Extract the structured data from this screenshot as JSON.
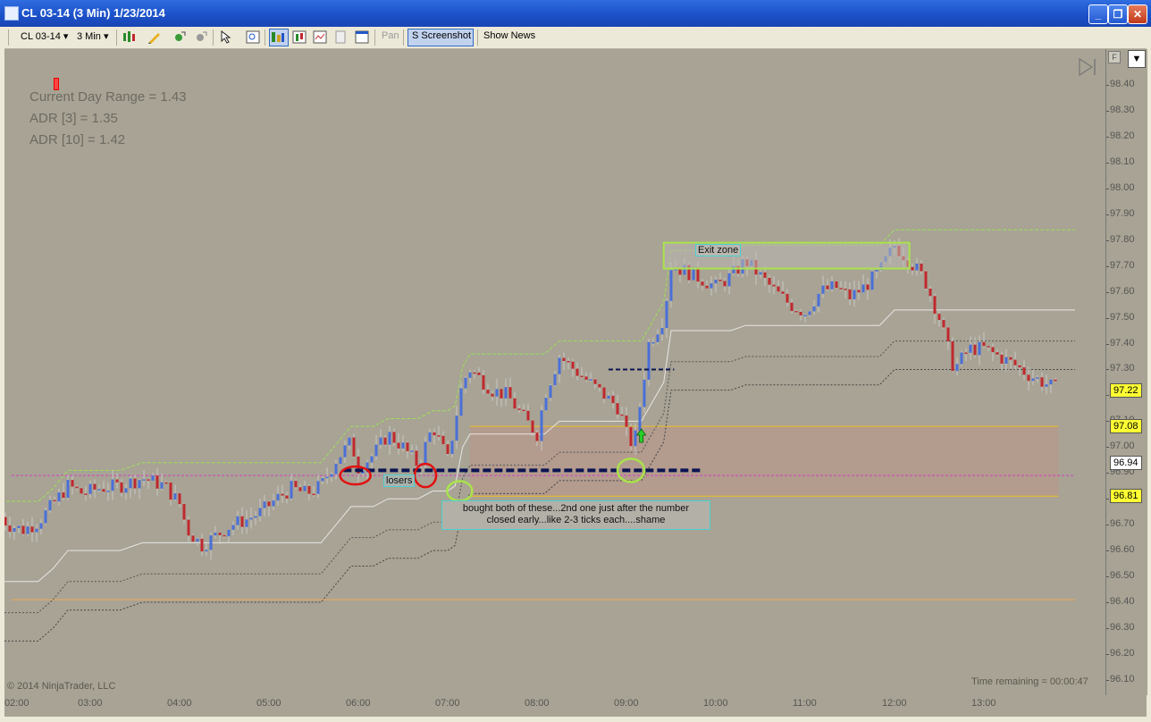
{
  "window": {
    "title": "CL 03-14 (3 Min)  1/23/2014",
    "buttons": [
      "_",
      "❐",
      "✕"
    ]
  },
  "toolbar": {
    "instrument": "CL 03-14",
    "interval": "3 Min",
    "pan": "Pan",
    "screenshot": "S Screenshot",
    "show_news": "Show News",
    "dropdown_arrow": "▾"
  },
  "stats": {
    "line1": "Current Day Range = 1.43",
    "line2": "ADR [3] = 1.35",
    "line3": "ADR [10] = 1.42"
  },
  "annotations": {
    "exit_zone": "Exit zone",
    "losers": "losers",
    "note_line1": "bought both of these...2nd one just after the number",
    "note_line2": "closed early...like 2-3 ticks each....shame"
  },
  "footer": {
    "copyright": "© 2014 NinjaTrader, LLC",
    "time_remaining": "Time remaining = 00:00:47"
  },
  "axis_panel": {
    "f_button": "F",
    "dropdown": "▼"
  },
  "price_axis": {
    "labels": [
      "98.40",
      "98.30",
      "98.20",
      "98.10",
      "98.00",
      "97.90",
      "97.80",
      "97.70",
      "97.60",
      "97.50",
      "97.40",
      "97.30",
      "97.20",
      "97.10",
      "97.00",
      "96.90",
      "96.80",
      "96.70",
      "96.60",
      "96.50",
      "96.40",
      "96.30",
      "96.20",
      "96.10"
    ],
    "top_value": 98.4,
    "bottom_value": 96.1
  },
  "price_tags": [
    {
      "label": "97.22",
      "value": 97.22,
      "bg": "#ffff33"
    },
    {
      "label": "97.08",
      "value": 97.08,
      "bg": "#ffff33"
    },
    {
      "label": "96.94",
      "value": 96.94,
      "bg": "#ffffff"
    },
    {
      "label": "96.81",
      "value": 96.81,
      "bg": "#ffff33"
    }
  ],
  "time_axis": {
    "labels": [
      "02:00",
      "03:00",
      "04:00",
      "05:00",
      "06:00",
      "07:00",
      "08:00",
      "09:00",
      "10:00",
      "11:00",
      "12:00",
      "13:00"
    ]
  },
  "colors": {
    "background": "#a8a394",
    "up_candle": "#4a6fd8",
    "down_candle": "#c0282e",
    "wick": "#c8c8c8",
    "zone_fill": "#b8978a",
    "magenta_line": "#d53fc0",
    "orange_line": "#f0a85a",
    "green_dashed": "#9de05a",
    "exit_zone_border": "#a9e34b",
    "annotation_border": "#4ad1d1"
  },
  "chart_data": {
    "type": "candlestick",
    "x_range": [
      "02:00",
      "13:50"
    ],
    "y_range": [
      96.1,
      98.4
    ],
    "levels": {
      "magenta_line": 96.89,
      "orange_line": 96.41,
      "zone_top": 97.08,
      "zone_bottom": 96.81,
      "exit_zone": [
        97.69,
        97.79
      ],
      "entry_dashed": 96.91,
      "short_dashed_0910": 97.3
    },
    "close_path": [
      [
        "02:00",
        96.73
      ],
      [
        "02:05",
        96.7
      ],
      [
        "02:15",
        96.68
      ],
      [
        "02:25",
        96.71
      ],
      [
        "02:35",
        96.78
      ],
      [
        "02:45",
        96.85
      ],
      [
        "02:55",
        96.82
      ],
      [
        "03:05",
        96.84
      ],
      [
        "03:20",
        96.85
      ],
      [
        "03:35",
        96.88
      ],
      [
        "03:50",
        96.85
      ],
      [
        "04:00",
        96.78
      ],
      [
        "04:05",
        96.68
      ],
      [
        "04:15",
        96.62
      ],
      [
        "04:25",
        96.66
      ],
      [
        "04:35",
        96.7
      ],
      [
        "04:45",
        96.72
      ],
      [
        "04:55",
        96.75
      ],
      [
        "05:05",
        96.8
      ],
      [
        "05:15",
        96.84
      ],
      [
        "05:25",
        96.82
      ],
      [
        "05:35",
        96.85
      ],
      [
        "05:45",
        96.95
      ],
      [
        "05:55",
        97.02
      ],
      [
        "06:00",
        96.92
      ],
      [
        "06:10",
        96.97
      ],
      [
        "06:20",
        97.05
      ],
      [
        "06:30",
        97.0
      ],
      [
        "06:40",
        96.93
      ],
      [
        "06:50",
        97.08
      ],
      [
        "07:00",
        96.95
      ],
      [
        "07:05",
        97.1
      ],
      [
        "07:10",
        97.25
      ],
      [
        "07:15",
        97.3
      ],
      [
        "07:30",
        97.22
      ],
      [
        "07:40",
        97.2
      ],
      [
        "07:50",
        97.12
      ],
      [
        "08:00",
        97.05
      ],
      [
        "08:05",
        97.2
      ],
      [
        "08:15",
        97.35
      ],
      [
        "08:25",
        97.3
      ],
      [
        "08:35",
        97.25
      ],
      [
        "08:45",
        97.2
      ],
      [
        "08:55",
        97.15
      ],
      [
        "09:00",
        97.05
      ],
      [
        "09:05",
        97.0
      ],
      [
        "09:10",
        97.2
      ],
      [
        "09:15",
        97.4
      ],
      [
        "09:25",
        97.5
      ],
      [
        "09:30",
        97.7
      ],
      [
        "09:40",
        97.68
      ],
      [
        "09:50",
        97.65
      ],
      [
        "10:00",
        97.62
      ],
      [
        "10:10",
        97.66
      ],
      [
        "10:20",
        97.72
      ],
      [
        "10:30",
        97.66
      ],
      [
        "10:40",
        97.6
      ],
      [
        "10:50",
        97.55
      ],
      [
        "11:00",
        97.52
      ],
      [
        "11:10",
        97.6
      ],
      [
        "11:20",
        97.62
      ],
      [
        "11:30",
        97.58
      ],
      [
        "11:40",
        97.62
      ],
      [
        "11:50",
        97.68
      ],
      [
        "12:00",
        97.78
      ],
      [
        "12:10",
        97.72
      ],
      [
        "12:20",
        97.65
      ],
      [
        "12:30",
        97.5
      ],
      [
        "12:40",
        97.3
      ],
      [
        "12:50",
        97.38
      ],
      [
        "13:00",
        97.38
      ],
      [
        "13:10",
        97.35
      ],
      [
        "13:20",
        97.32
      ],
      [
        "13:30",
        97.28
      ],
      [
        "13:40",
        97.25
      ],
      [
        "13:50",
        97.22
      ]
    ]
  }
}
